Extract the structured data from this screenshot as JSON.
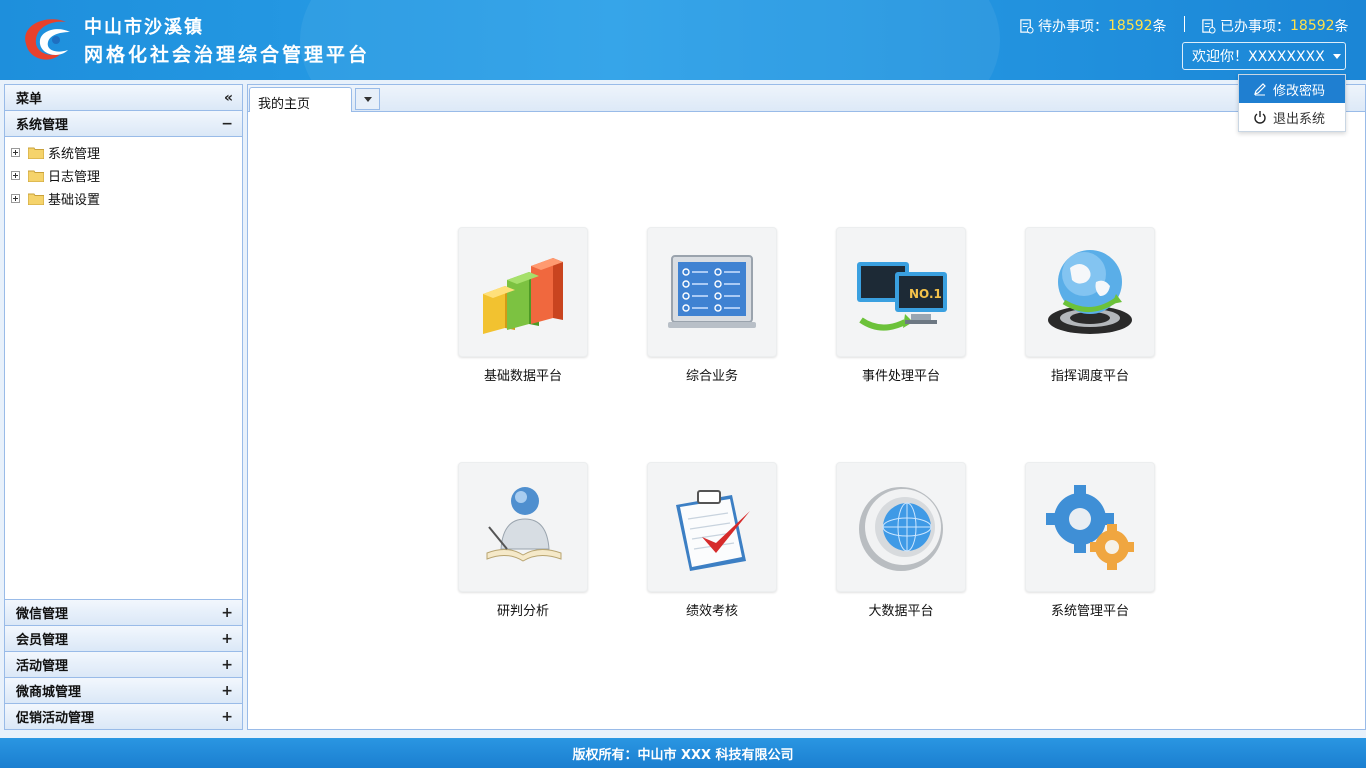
{
  "header": {
    "title_line1": "中山市沙溪镇",
    "title_line2": "网格化社会治理综合管理平台",
    "pending_label": "待办事项：",
    "pending_count": "18592",
    "pending_unit": "条",
    "done_label": "已办事项：",
    "done_count": "18592",
    "done_unit": "条",
    "welcome": "欢迎你！XXXXXXXX"
  },
  "dropdown": {
    "change_password": "修改密码",
    "logout": "退出系统"
  },
  "sidebar": {
    "menu_title": "菜单",
    "collapse_glyph": "«",
    "active_panel": {
      "label": "系统管理",
      "tool": "−"
    },
    "tree": [
      "系统管理",
      "日志管理",
      "基础设置"
    ],
    "panels": [
      {
        "label": "微信管理",
        "tool": "+"
      },
      {
        "label": "会员管理",
        "tool": "+"
      },
      {
        "label": "活动管理",
        "tool": "+"
      },
      {
        "label": "微商城管理",
        "tool": "+"
      },
      {
        "label": "促销活动管理",
        "tool": "+"
      }
    ]
  },
  "tabs": {
    "home": "我的主页"
  },
  "tiles": [
    {
      "label": "基础数据平台",
      "icon": "bar-chart-icon"
    },
    {
      "label": "综合业务",
      "icon": "checklist-monitor-icon"
    },
    {
      "label": "事件处理平台",
      "icon": "monitors-icon"
    },
    {
      "label": "指挥调度平台",
      "icon": "globe-icon"
    },
    {
      "label": "研判分析",
      "icon": "person-book-icon"
    },
    {
      "label": "绩效考核",
      "icon": "clipboard-check-icon"
    },
    {
      "label": "大数据平台",
      "icon": "data-disc-icon"
    },
    {
      "label": "系统管理平台",
      "icon": "gears-icon"
    }
  ],
  "footer": {
    "copyright": "版权所有：中山市 XXX 科技有限公司"
  },
  "colors": {
    "header": "#1e8fdc",
    "accent_number": "#ffe14a",
    "panel_border": "#99bbe8",
    "menu_active": "#1f7fd1"
  }
}
